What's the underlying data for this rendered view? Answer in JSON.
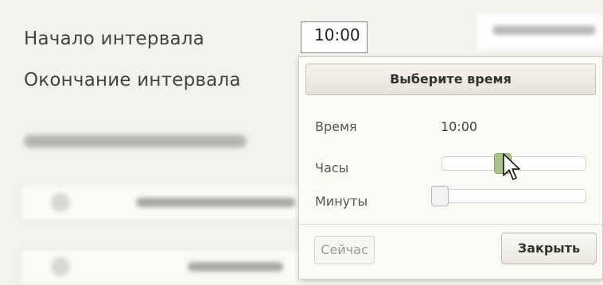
{
  "form": {
    "start_label": "Начало интервала",
    "start_value": "10:00",
    "end_label": "Окончание интервала"
  },
  "time_picker": {
    "header": "Выберите время",
    "time_label": "Время",
    "time_value": "10:00",
    "hours_label": "Часы",
    "minutes_label": "Минуты",
    "hours_slider_fraction": 0.42,
    "minutes_slider_fraction": 0.0,
    "now_button": "Сейчас",
    "close_button": "Закрыть"
  },
  "colors": {
    "hour_handle": "#a9c388",
    "background": "#f3f2ec"
  },
  "icons": {
    "cursor": "arrow-cursor-icon"
  }
}
